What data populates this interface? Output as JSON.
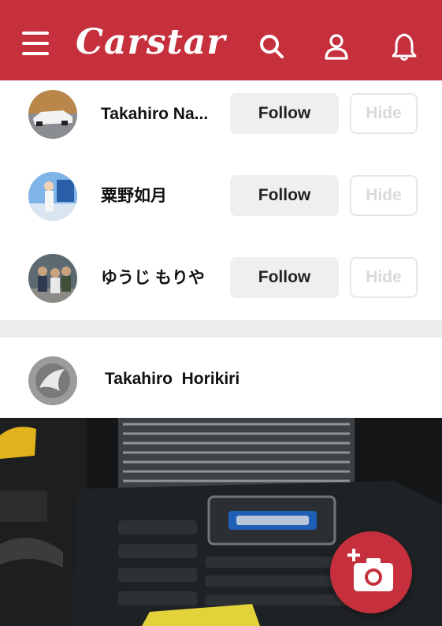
{
  "header": {
    "logo_text": "Carstar",
    "icons": [
      "menu-icon",
      "search-icon",
      "user-icon",
      "bell-icon"
    ],
    "brand_color": "#c6303c"
  },
  "suggestions": [
    {
      "name": "Takahiro Na...",
      "follow_label": "Follow",
      "hide_label": "Hide"
    },
    {
      "name": "粟野如月",
      "follow_label": "Follow",
      "hide_label": "Hide"
    },
    {
      "name": "ゆうじ もりや",
      "follow_label": "Follow",
      "hide_label": "Hide"
    }
  ],
  "post": {
    "author": "Takahiro  Horikiri"
  },
  "fab": {
    "icon": "add-photo-icon"
  }
}
